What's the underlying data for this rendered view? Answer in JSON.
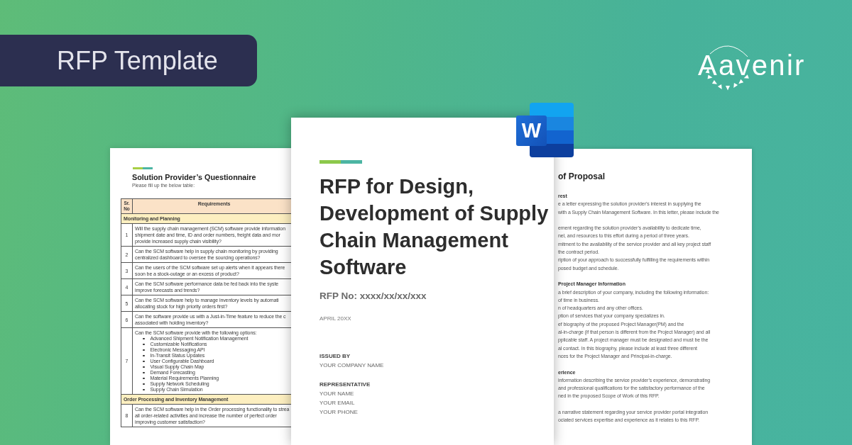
{
  "banner": {
    "label": "RFP Template"
  },
  "brand_logo": {
    "text": "Aavenir"
  },
  "app_logo": {
    "letter": "W"
  },
  "questionnaire_page": {
    "title": "Solution Provider’s Questionnaire",
    "subtitle": "Please fill up the below table:",
    "table": {
      "columns": [
        "Sr. No",
        "Requirements"
      ],
      "rows": [
        {
          "kind": "section",
          "label": "Monitoring and Planning"
        },
        {
          "kind": "question",
          "number": "1",
          "lines": [
            "Will the supply chain management (SCM) software provide information",
            "shipment date and time, ID and order numbers, freight data and mor",
            "provide increased supply chain visibility?"
          ]
        },
        {
          "kind": "question",
          "number": "2",
          "lines": [
            "Can the SCM software help in supply chain monitoring by providing",
            "centralized dashboard to oversee the sourcing operations?"
          ]
        },
        {
          "kind": "question",
          "number": "3",
          "lines": [
            "Can the users of the SCM software set up alerts when it appears there",
            "soon be a stock-outage or an excess of product?"
          ]
        },
        {
          "kind": "question",
          "number": "4",
          "lines": [
            "Can the SCM software performance data be fed back into the syste",
            "improve forecasts and trends?"
          ]
        },
        {
          "kind": "question",
          "number": "5",
          "lines": [
            "Can the SCM software help to manage inventory levels by automati",
            "allocating stock for high priority orders first?"
          ]
        },
        {
          "kind": "question",
          "number": "6",
          "lines": [
            "Can the software provide us with a Just-in-Time feature to reduce the c",
            "associated with holding inventory?"
          ]
        },
        {
          "kind": "question",
          "number": "7",
          "lines": [
            "Can the SCM software provide with the following options:"
          ],
          "options": [
            "Advanced Shipment Notification Management",
            "Customizable Notifications",
            "Electronic Messaging API",
            "In-Transit Status Updates",
            "User Configurable Dashboard",
            "Visual Supply Chain Map",
            "Demand Forecasting",
            "Material Requirements Planning",
            "Supply Network Scheduling",
            "Supply Chain Simulation"
          ]
        },
        {
          "kind": "section",
          "label": "Order Processing and Inventory Management"
        },
        {
          "kind": "question",
          "number": "8",
          "lines": [
            "Can the SCM software help in the Order processing functionality to strea",
            "all order-related activities and increase the number of perfect order",
            "improving customer satisfaction?"
          ]
        }
      ]
    }
  },
  "cover_page": {
    "title": "RFP for Design, Development of Supply Chain Management Software",
    "rfp_number": "RFP No: xxxx/xx/xx/xxx",
    "date": "APRIL 20XX",
    "blocks": [
      {
        "heading": "ISSUED BY",
        "lines": [
          "YOUR COMPANY NAME"
        ]
      },
      {
        "heading": "REPRESENTATIVE",
        "lines": [
          "YOUR NAME",
          "YOUR EMAIL",
          "YOUR PHONE"
        ]
      }
    ]
  },
  "proposal_page": {
    "title": "of Proposal",
    "sections": [
      {
        "heading": "rest",
        "paragraphs": [
          [
            "e a letter expressing the solution provider’s interest in supplying the",
            "with a Supply Chain Management Software. In this letter, please include the"
          ],
          [
            "ement regarding the solution provider’s availability to dedicate time,",
            "nel, and resources to this effort during a period of three years.",
            "mitment to the availability of the service provider and all key project staff",
            "the contract period.",
            "ription of your approach to successfully fulfilling the requirements within",
            "posed budget and schedule."
          ]
        ]
      },
      {
        "heading": "Project Manager Information",
        "paragraphs": [
          [
            "a brief description of your company, including the following information:",
            "of time in business.",
            "n of headquarters and any other offices.",
            "ption of services that your company specializes in.",
            "ef biography of the proposed Project Manager(PM) and the",
            "al-in-charge (if that person is different from the Project Manager) and all",
            "pplicable staff. A project manager must be designated and must be the",
            "al contact. In this biography, please include at least three different",
            "nces for the Project Manager and Principal-in-charge."
          ]
        ]
      },
      {
        "heading": "erience",
        "paragraphs": [
          [
            "information describing the service provider’s experience, demonstrating",
            "and professional qualifications for the satisfactory performance of the",
            "ned in the proposed Scope of Work of this RFP."
          ],
          [
            "a narrative statement regarding your service provider portal integration",
            "ociated services expertise and experience as it relates to this RFP."
          ]
        ]
      }
    ]
  }
}
